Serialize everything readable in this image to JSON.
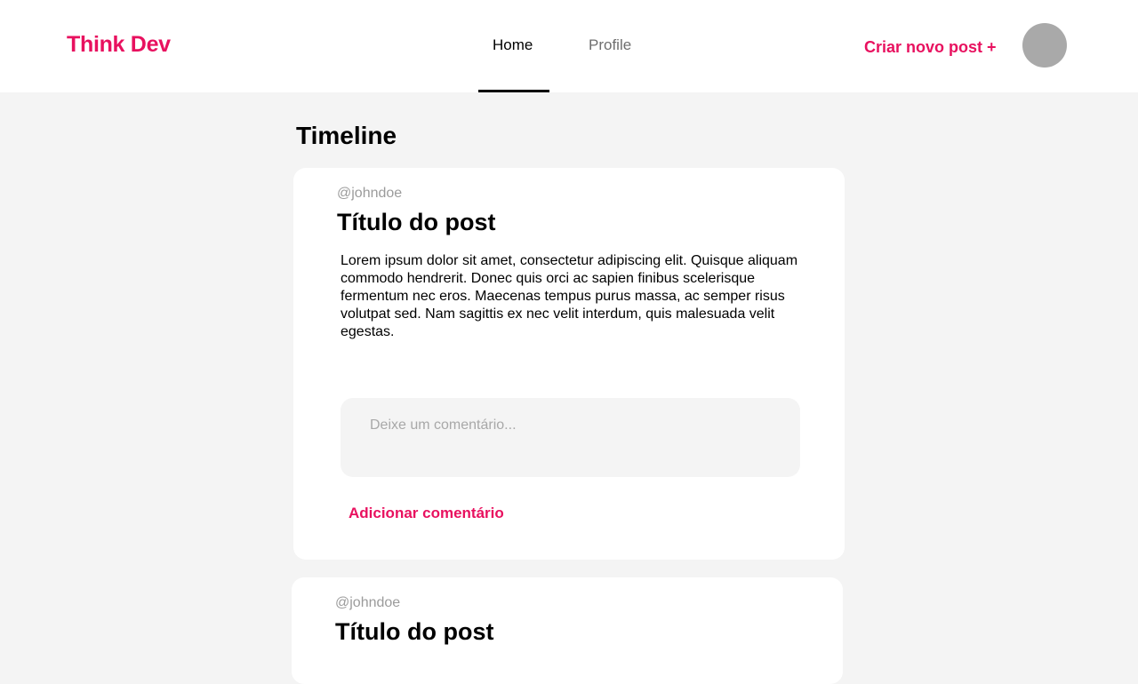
{
  "header": {
    "logo": "Think Dev",
    "nav": [
      {
        "label": "Home",
        "active": true
      },
      {
        "label": "Profile",
        "active": false
      }
    ],
    "create_post_label": "Criar novo post +"
  },
  "timeline": {
    "title": "Timeline",
    "posts": [
      {
        "username": "@johndoe",
        "title": "Título do post",
        "body": "Lorem ipsum dolor sit amet, consectetur adipiscing elit. Quisque aliquam commodo hendrerit. Donec quis orci ac sapien finibus scelerisque fermentum nec eros. Maecenas tempus purus massa, ac semper risus volutpat sed. Nam sagittis ex nec velit interdum, quis malesuada velit egestas.",
        "comment_placeholder": "Deixe um comentário...",
        "add_comment_label": "Adicionar comentário"
      },
      {
        "username": "@johndoe",
        "title": "Título do post"
      }
    ]
  },
  "colors": {
    "accent": "#e8115f",
    "background": "#f4f4f4",
    "card": "#ffffff",
    "avatar": "#a9a9a9"
  }
}
